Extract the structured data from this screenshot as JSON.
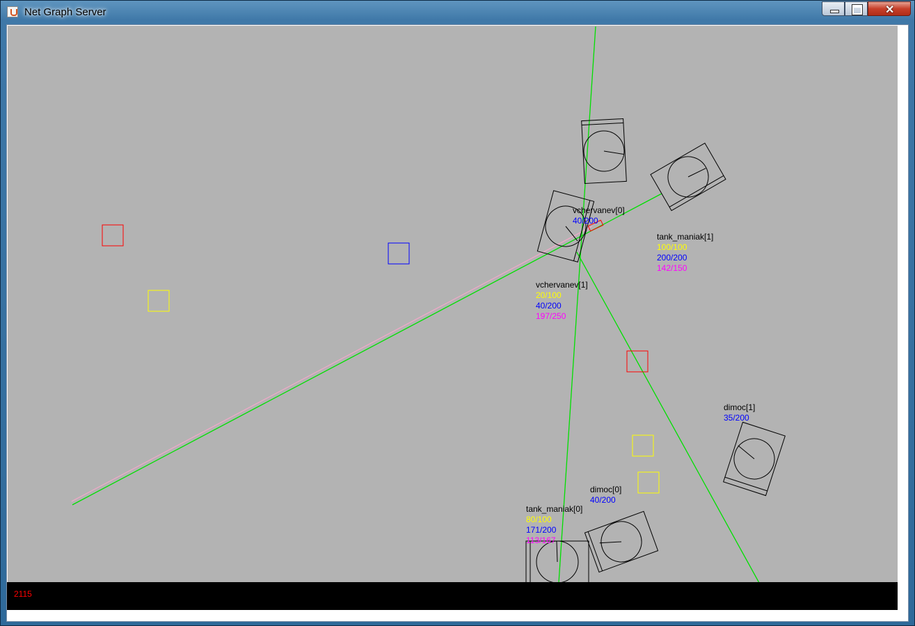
{
  "window": {
    "title": "Net Graph Server",
    "icon": "java-cup-icon",
    "controls": {
      "minimize": "minimize-icon",
      "maximize": "maximize-icon",
      "close": "close-icon",
      "close_glyph": "✕"
    }
  },
  "game": {
    "field_color": "#b3b3b3",
    "status_value": "2115",
    "status_color": "#ff0000",
    "hp_color": "#ffff00",
    "energy_color": "#0000ff",
    "ammo_color": "#ff00ff",
    "players": [
      {
        "name": "vchervanev[0]",
        "stats": [
          "40/200"
        ]
      },
      {
        "name": "tank_maniak[1]",
        "stats": [
          "100/100",
          "200/200",
          "142/150"
        ]
      },
      {
        "name": "vchervanev[1]",
        "stats": [
          "20/100",
          "40/200",
          "197/250"
        ]
      },
      {
        "name": "dimoc[1]",
        "stats": [
          "35/200"
        ]
      },
      {
        "name": "dimoc[0]",
        "stats": [
          "40/200"
        ]
      },
      {
        "name": "tank_maniak[0]",
        "stats": [
          "80/100",
          "171/200",
          "113/167"
        ]
      }
    ]
  }
}
